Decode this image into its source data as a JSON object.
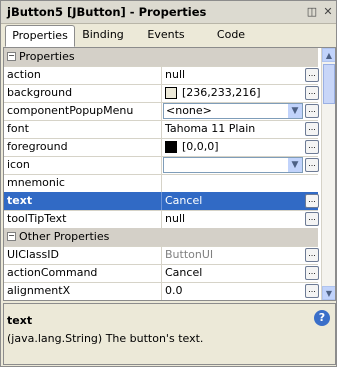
{
  "window": {
    "title": "jButton5 [JButton] - Properties",
    "pin_icon": "pin-icon",
    "close_icon": "close-icon"
  },
  "tabs": [
    "Properties",
    "Binding",
    "Events",
    "Code"
  ],
  "sections": {
    "properties": "Properties",
    "other": "Other Properties"
  },
  "rows": [
    {
      "name": "action",
      "value": "null"
    },
    {
      "name": "background",
      "value": "[236,233,216]",
      "swatch": "#ece9d8"
    },
    {
      "name": "componentPopupMenu",
      "value": "<none>"
    },
    {
      "name": "font",
      "value": "Tahoma 11 Plain"
    },
    {
      "name": "foreground",
      "value": "[0,0,0]",
      "swatch": "#000000"
    },
    {
      "name": "icon",
      "value": ""
    },
    {
      "name": "mnemonic",
      "value": ""
    },
    {
      "name": "text",
      "value": "Cancel"
    },
    {
      "name": "toolTipText",
      "value": "null"
    },
    {
      "name": "UIClassID",
      "value": "ButtonUI"
    },
    {
      "name": "actionCommand",
      "value": "Cancel"
    },
    {
      "name": "alignmentX",
      "value": "0.0"
    }
  ],
  "ellipsis": "...",
  "description": {
    "title": "text",
    "body": "(java.lang.String)  The button's text."
  },
  "colors": {
    "selection": "#316ac5",
    "category": "#d4d0c8"
  }
}
